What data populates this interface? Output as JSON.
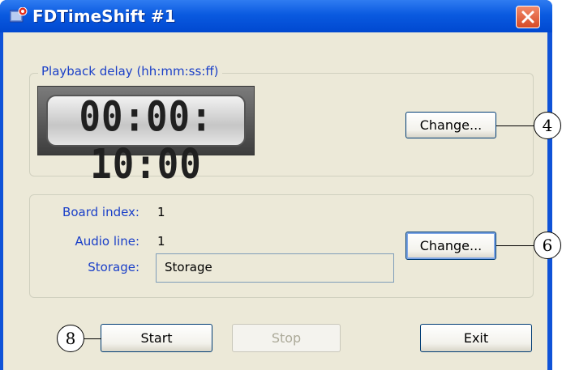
{
  "window": {
    "title": "FDTimeShift #1"
  },
  "delay_group": {
    "title": "Playback delay (hh:mm:ss:ff)",
    "display": "00:00: 10:00",
    "change_label": "Change..."
  },
  "info_group": {
    "board_index_label": "Board index:",
    "board_index_value": "1",
    "audio_line_label": "Audio line:",
    "audio_line_value": "1",
    "storage_label": "Storage:",
    "storage_value": "Storage",
    "change_label": "Change..."
  },
  "buttons": {
    "start": "Start",
    "stop": "Stop",
    "exit": "Exit"
  },
  "callouts": {
    "delay_change": "4",
    "info_change": "6",
    "start": "8"
  },
  "colors": {
    "title_bar": "#0a5ae0",
    "label_text": "#1a3fc8",
    "client_bg": "#ece9d8",
    "close_red": "#d64a26"
  },
  "icons": {
    "app": "fdtimeshift-app-icon",
    "close": "close-icon"
  }
}
